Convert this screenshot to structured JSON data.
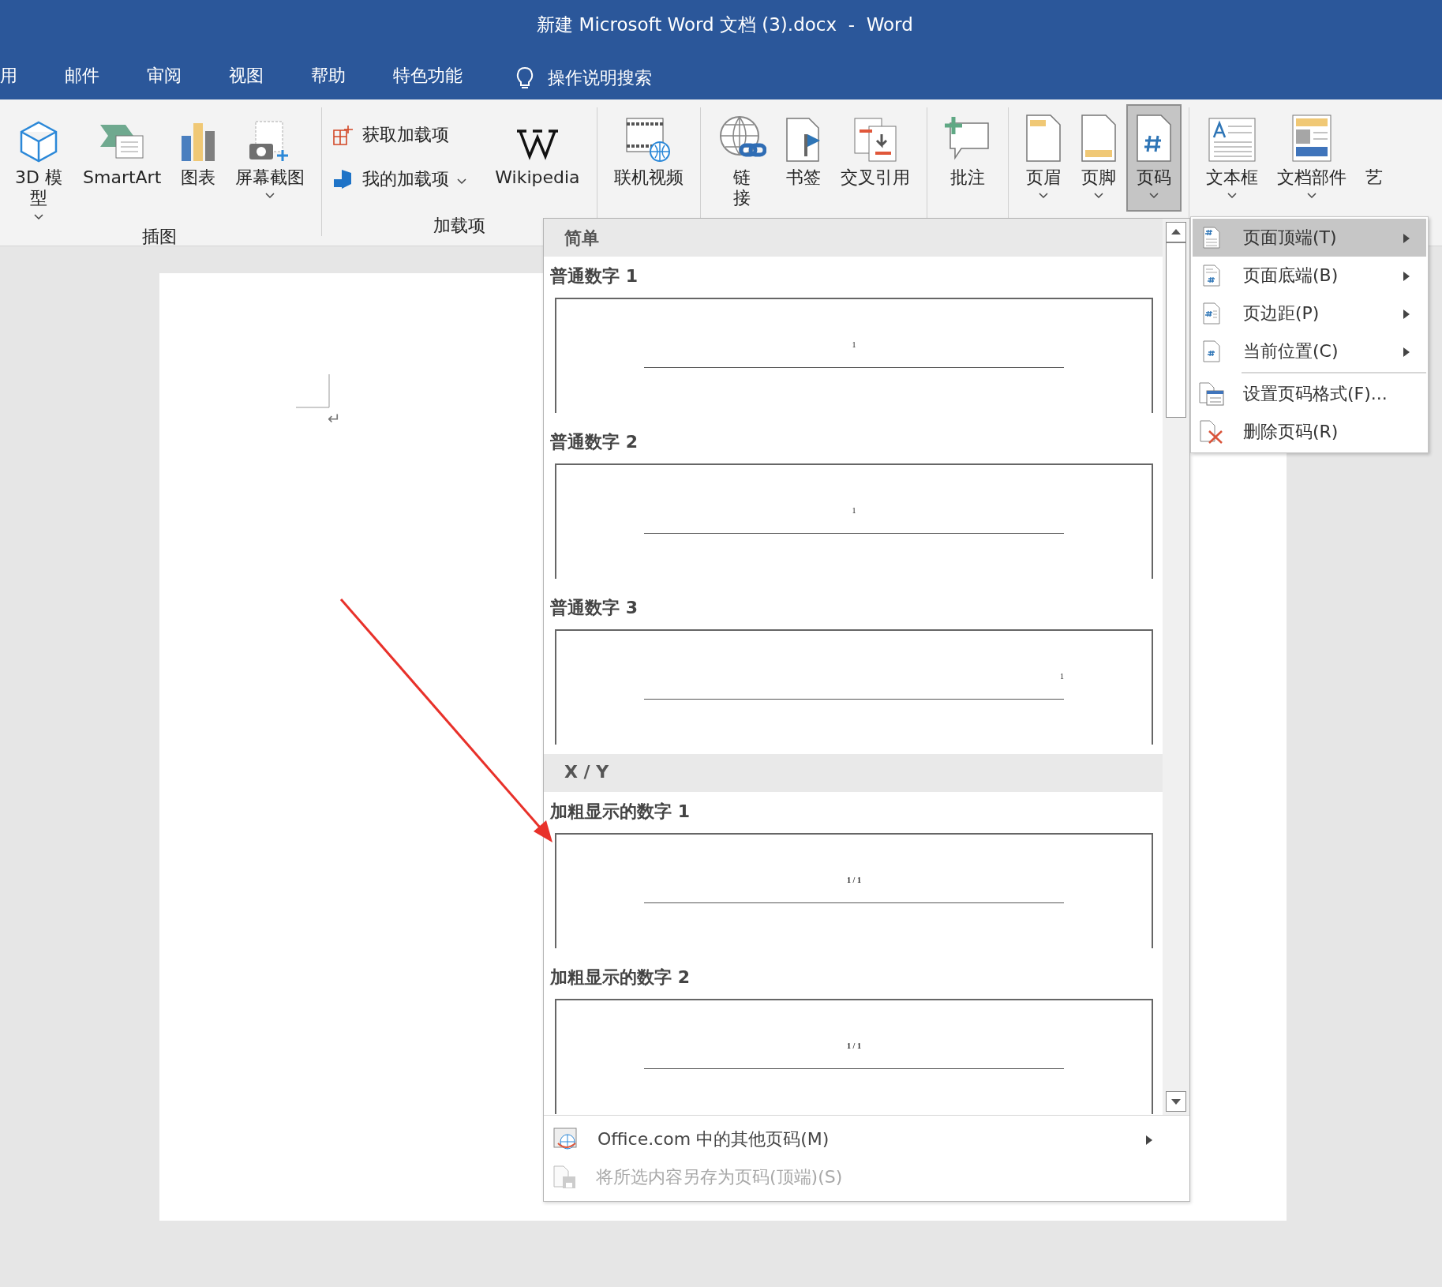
{
  "window": {
    "title": "新建 Microsoft Word 文档 (3).docx  -  Word"
  },
  "tabs": [
    {
      "label": "用",
      "selected": false
    },
    {
      "label": "邮件",
      "selected": false
    },
    {
      "label": "审阅",
      "selected": false
    },
    {
      "label": "视图",
      "selected": false
    },
    {
      "label": "帮助",
      "selected": false
    },
    {
      "label": "特色功能",
      "selected": false
    }
  ],
  "search": {
    "label": "操作说明搜索"
  },
  "ribbon": {
    "groups": [
      {
        "label": "插图",
        "buttons": [
          {
            "label": "3D 模型",
            "dropdown": true,
            "selected": false
          },
          {
            "label": "SmartArt",
            "dropdown": false,
            "selected": false
          },
          {
            "label": "图表",
            "dropdown": false,
            "selected": false
          },
          {
            "label": "屏幕截图",
            "dropdown": true,
            "selected": false
          }
        ]
      },
      {
        "label": "加载项",
        "small": [
          {
            "label": "获取加载项",
            "dropdown": false
          },
          {
            "label": "我的加载项",
            "dropdown": true
          }
        ],
        "buttons": [
          {
            "label": "Wikipedia",
            "dropdown": false,
            "selected": false
          }
        ]
      },
      {
        "buttons": [
          {
            "label": "联机视频",
            "dropdown": false,
            "selected": false
          }
        ]
      },
      {
        "buttons": [
          {
            "label": "链接",
            "dropdown": false,
            "selected": false
          },
          {
            "label": "书签",
            "dropdown": false,
            "selected": false
          },
          {
            "label": "交叉引用",
            "dropdown": false,
            "selected": false
          }
        ]
      },
      {
        "buttons": [
          {
            "label": "批注",
            "dropdown": false,
            "selected": false
          }
        ]
      },
      {
        "buttons": [
          {
            "label": "页眉",
            "dropdown": true,
            "selected": false
          },
          {
            "label": "页脚",
            "dropdown": true,
            "selected": false
          },
          {
            "label": "页码",
            "dropdown": true,
            "selected": true
          }
        ]
      },
      {
        "buttons": [
          {
            "label": "文本框",
            "dropdown": true,
            "selected": false
          },
          {
            "label": "文档部件",
            "dropdown": true,
            "selected": false
          },
          {
            "label": "艺"
          }
        ]
      }
    ]
  },
  "document": {
    "paragraph_mark": "↵"
  },
  "gallery": {
    "sections": [
      {
        "heading": "简单",
        "items": [
          {
            "label": "普通数字 1",
            "preview": "1",
            "kind": "centered"
          },
          {
            "label": "普通数字 2",
            "preview": "1",
            "kind": "centered"
          },
          {
            "label": "普通数字 3",
            "preview": "1",
            "kind": "right-aligned"
          }
        ]
      },
      {
        "heading": "X / Y",
        "items": [
          {
            "label": "加粗显示的数字 1",
            "preview": "1 / 1",
            "kind": "centered"
          },
          {
            "label": "加粗显示的数字 2",
            "preview": "1 / 1",
            "kind": "centered"
          }
        ]
      }
    ],
    "footer": [
      {
        "label": "Office.com 中的其他页码(M)",
        "submenu": true,
        "disabled": false
      },
      {
        "label": "将所选内容另存为页码(顶端)(S)",
        "submenu": false,
        "disabled": true
      }
    ]
  },
  "submenu": {
    "items": [
      {
        "label": "页面顶端(T)",
        "submenu": true,
        "selected": true,
        "separator_before": false
      },
      {
        "label": "页面底端(B)",
        "submenu": true,
        "selected": false,
        "separator_before": false
      },
      {
        "label": "页边距(P)",
        "submenu": true,
        "selected": false,
        "separator_before": false
      },
      {
        "label": "当前位置(C)",
        "submenu": true,
        "selected": false,
        "separator_before": false
      },
      {
        "label": "设置页码格式(F)...",
        "submenu": false,
        "selected": false,
        "separator_before": true
      },
      {
        "label": "删除页码(R)",
        "submenu": false,
        "selected": false,
        "separator_before": false
      }
    ]
  }
}
